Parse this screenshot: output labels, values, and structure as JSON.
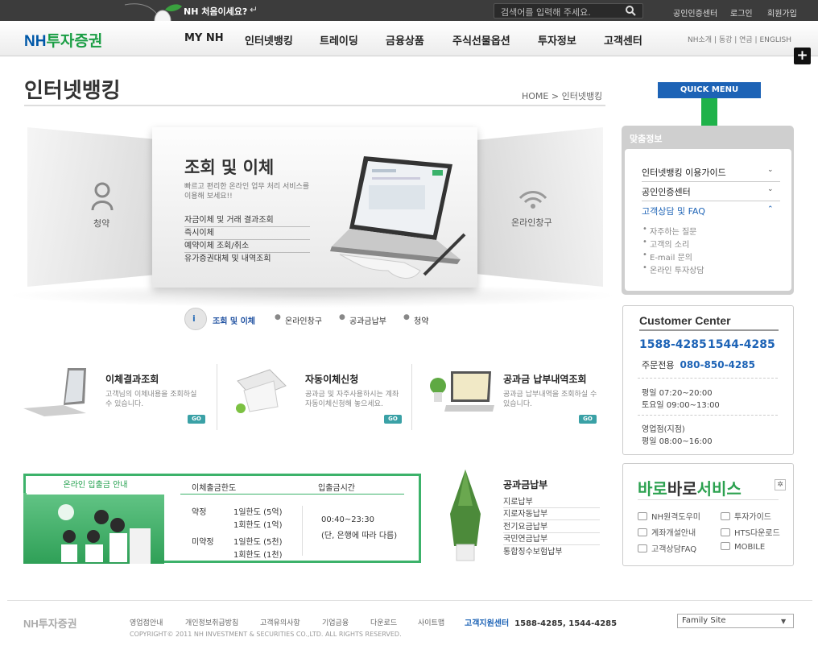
{
  "topbar": {
    "first_visit": "NH 처음이세요?",
    "search_placeholder": "검색어를 입력해 주세요.",
    "links": [
      "공인인증센터",
      "로그인",
      "회원가입"
    ]
  },
  "header": {
    "logo_nh": "NH",
    "logo_text": "투자증권",
    "nav": [
      "MY NH",
      "인터넷뱅킹",
      "트레이딩",
      "금융상품",
      "주식선물옵션",
      "투자정보",
      "고객센터"
    ],
    "util": "NH소개 | 동강 | 연금 | ENGLISH"
  },
  "page": {
    "title": "인터넷뱅킹",
    "breadcrumb": "HOME > 인터넷뱅킹",
    "quick_menu": "QUICK MENU"
  },
  "hero": {
    "title": "조회 및 이체",
    "desc": "빠르고 편리한 온라인 업무 처리 서비스를 이용해 보세요!!",
    "items": [
      "자금이체 및 거래 결과조회",
      "즉시이체",
      "예약이체 조회/취소",
      "유가증권대체 및 내역조회"
    ],
    "left_label": "청약",
    "right_label": "온라인창구",
    "tabs": [
      "조회 및 이체",
      "온라인창구",
      "공과금납부",
      "청약"
    ]
  },
  "services": [
    {
      "title": "이체결과조회",
      "desc": "고객님의 이체내용을 조회하실 수 있습니다.",
      "go": "GO"
    },
    {
      "title": "자동이체신청",
      "desc": "공과금 및 자주사용하시는 계좌 자동이체신청해 놓으세요.",
      "go": "GO"
    },
    {
      "title": "공과금 납부내역조회",
      "desc": "공과금 납부내역을 조회하실 수 있습니다.",
      "go": "GO"
    }
  ],
  "limit": {
    "tab": "온라인 입출금 안내",
    "col1": "이체출금한도",
    "col2": "입출금시간",
    "rows": [
      {
        "type": "약정",
        "l1": "1일한도 (5억)",
        "l2": "1회한도 (1억)"
      },
      {
        "type": "미약정",
        "l1": "1일한도 (5천)",
        "l2": "1회한도 (1천)"
      }
    ],
    "time": "00:40~23:30",
    "time_note": "(단, 은행에 따라 다름)"
  },
  "tax": {
    "title": "공과금납부",
    "links": [
      "지로납부",
      "지로자동납부",
      "전기요금납부",
      "국민연금납부",
      "통합징수보험납부"
    ]
  },
  "sidebar": {
    "custom_info_title": "맞춤정보",
    "items": [
      "인터넷뱅킹 이용가이드",
      "공인인증센터",
      "고객상담 및 FAQ"
    ],
    "sub_items": [
      "자주하는 질문",
      "고객의 소리",
      "E-mail 문의",
      "온라인 투자상담"
    ],
    "cc_title": "Customer Center",
    "phone1": "1588-4285",
    "phone2": "1544-4285",
    "dedicated_label": "주문전용",
    "dedicated_phone": "080-850-4285",
    "hours": [
      "평일 07:20~20:00",
      "토요일 09:00~13:00",
      "영업점(지점)",
      "평일 08:00~16:00"
    ],
    "service_logo_a": "바로",
    "service_logo_b": "바로",
    "service_logo_c": "서비스",
    "service_links": [
      "NH원격도우미",
      "투자가이드",
      "계좌개설안내",
      "HTS다운로드",
      "고객상담FAQ",
      "MOBILE"
    ]
  },
  "footer": {
    "logo": "NH투자증권",
    "links": [
      "영업점안내",
      "개인정보취급방침",
      "고객유의사항",
      "기업금융",
      "다운로드",
      "사이트맵"
    ],
    "center_label": "고객지원센터",
    "center_phones": "1588-4285, 1544-4285",
    "copyright": "COPYRIGHT© 2011 NH INVESTMENT & SECURITIES CO.,LTD. ALL RIGHTS RESERVED.",
    "family_site": "Family Site"
  },
  "colors": {
    "brand_blue": "#1d63b6",
    "brand_green": "#1fb24a",
    "teal_go": "#3aa1a6"
  }
}
